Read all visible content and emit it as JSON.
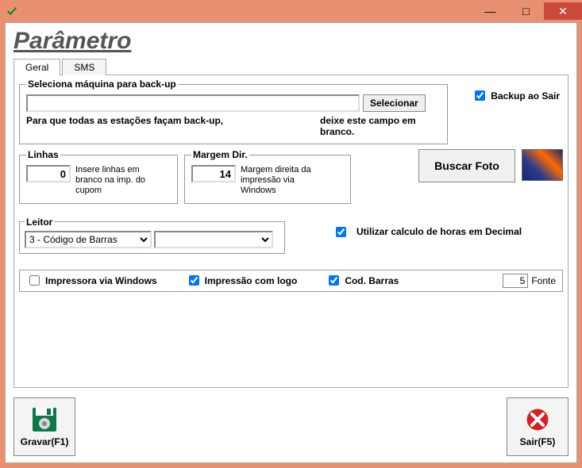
{
  "window": {
    "title": "",
    "minimize": "—",
    "maximize": "□",
    "close": "✕"
  },
  "page_title": "Parâmetro",
  "tabs": {
    "geral": "Geral",
    "sms": "SMS"
  },
  "backup": {
    "legend": "Seleciona máquina para back-up",
    "path": "",
    "selecionar": "Selecionar",
    "note_left": "Para que todas as  estações façam back-up,",
    "note_right": "deixe este campo em branco.",
    "backup_ao_sair": "Backup ao Sair"
  },
  "linhas": {
    "legend": "Linhas",
    "value": "0",
    "desc": "Insere linhas  em branco na imp. do cupom"
  },
  "margem": {
    "legend": "Margem Dir.",
    "value": "14",
    "desc": "Margem direita da impressão via Windows"
  },
  "buscar_foto": "Buscar Foto",
  "leitor": {
    "legend": "Leitor",
    "value": "3 - Código de Barras",
    "value2": ""
  },
  "decimal": "Utilizar calculo de horas em Decimal",
  "printrow": {
    "impressora": "Impressora via Windows",
    "logo": "Impressão com logo",
    "cod_barras": "Cod. Barras",
    "fonte_value": "5",
    "fonte_label": "Fonte"
  },
  "footer": {
    "gravar": "Gravar(F1)",
    "sair": "Sair(F5)"
  }
}
